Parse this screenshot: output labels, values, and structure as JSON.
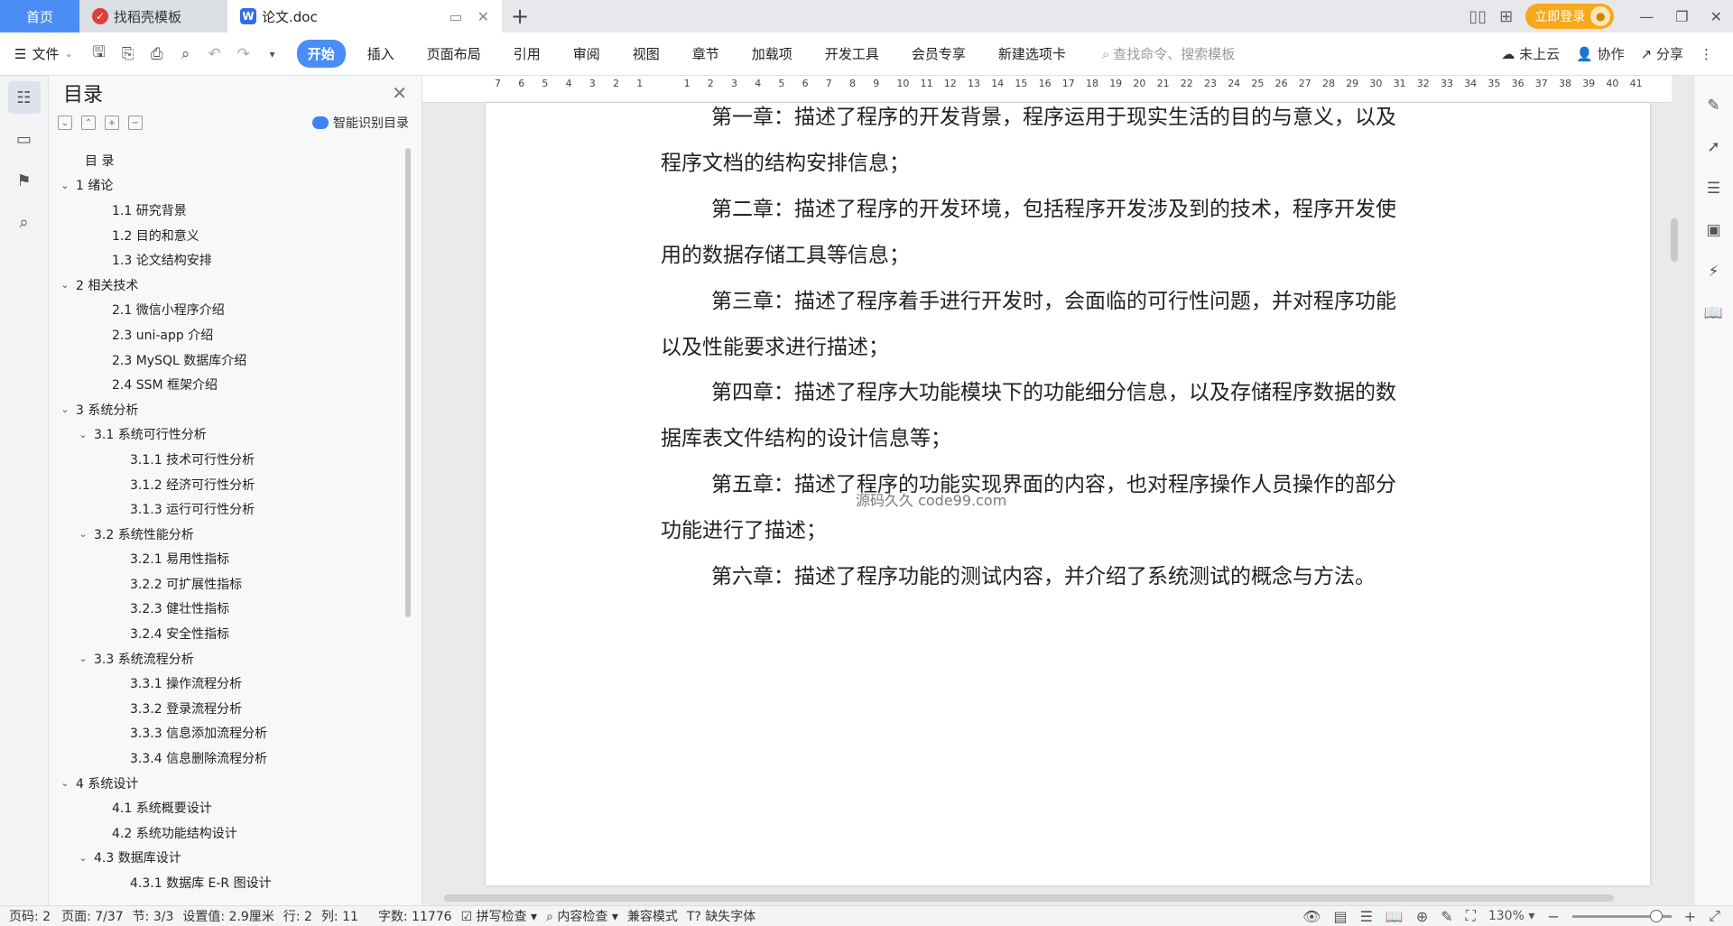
{
  "tabs": {
    "home": "首页",
    "template": "找稻壳模板",
    "doc": "论文.doc"
  },
  "title_right": {
    "login": "立即登录"
  },
  "menu": {
    "file": "文件",
    "ribbon_tabs": [
      "开始",
      "插入",
      "页面布局",
      "引用",
      "审阅",
      "视图",
      "章节",
      "加载项",
      "开发工具",
      "会员专享",
      "新建选项卡"
    ],
    "search_placeholder": "查找命令、搜索模板",
    "cloud": "未上云",
    "collab": "协作",
    "share": "分享"
  },
  "toc": {
    "title": "目录",
    "smart": "智能识别目录",
    "items": [
      {
        "text": "目 录",
        "level": 0,
        "chev": false
      },
      {
        "text": "1 绪论",
        "level": 0,
        "chev": true
      },
      {
        "text": "1.1  研究背景",
        "level": 1,
        "chev": false
      },
      {
        "text": "1.2  目的和意义",
        "level": 1,
        "chev": false
      },
      {
        "text": "1.3  论文结构安排",
        "level": 1,
        "chev": false
      },
      {
        "text": "2 相关技术",
        "level": 0,
        "chev": true
      },
      {
        "text": "2.1  微信小程序介绍",
        "level": 1,
        "chev": false
      },
      {
        "text": "2.3 uni-app 介绍",
        "level": 1,
        "chev": false
      },
      {
        "text": "2.3 MySQL 数据库介绍",
        "level": 1,
        "chev": false
      },
      {
        "text": "2.4 SSM 框架介绍",
        "level": 1,
        "chev": false
      },
      {
        "text": "3 系统分析",
        "level": 0,
        "chev": true
      },
      {
        "text": "3.1  系统可行性分析",
        "level": 1,
        "chev": true
      },
      {
        "text": "3.1.1  技术可行性分析",
        "level": 2,
        "chev": false
      },
      {
        "text": "3.1.2  经济可行性分析",
        "level": 2,
        "chev": false
      },
      {
        "text": "3.1.3  运行可行性分析",
        "level": 2,
        "chev": false
      },
      {
        "text": "3.2  系统性能分析",
        "level": 1,
        "chev": true
      },
      {
        "text": "3.2.1  易用性指标",
        "level": 2,
        "chev": false
      },
      {
        "text": "3.2.2  可扩展性指标",
        "level": 2,
        "chev": false
      },
      {
        "text": "3.2.3  健壮性指标",
        "level": 2,
        "chev": false
      },
      {
        "text": "3.2.4  安全性指标",
        "level": 2,
        "chev": false
      },
      {
        "text": "3.3  系统流程分析",
        "level": 1,
        "chev": true
      },
      {
        "text": "3.3.1  操作流程分析",
        "level": 2,
        "chev": false
      },
      {
        "text": "3.3.2  登录流程分析",
        "level": 2,
        "chev": false
      },
      {
        "text": "3.3.3  信息添加流程分析",
        "level": 2,
        "chev": false
      },
      {
        "text": "3.3.4  信息删除流程分析",
        "level": 2,
        "chev": false
      },
      {
        "text": "4 系统设计",
        "level": 0,
        "chev": true
      },
      {
        "text": "4.1  系统概要设计",
        "level": 1,
        "chev": false
      },
      {
        "text": "4.2  系统功能结构设计",
        "level": 1,
        "chev": false
      },
      {
        "text": "4.3  数据库设计",
        "level": 1,
        "chev": true
      },
      {
        "text": "4.3.1  数据库 E-R 图设计",
        "level": 2,
        "chev": false
      }
    ]
  },
  "ruler_ticks": [
    "7",
    "6",
    "5",
    "4",
    "3",
    "2",
    "1",
    "",
    "1",
    "2",
    "3",
    "4",
    "5",
    "6",
    "7",
    "8",
    "9",
    "10",
    "11",
    "12",
    "13",
    "14",
    "15",
    "16",
    "17",
    "18",
    "19",
    "20",
    "21",
    "22",
    "23",
    "24",
    "25",
    "26",
    "27",
    "28",
    "29",
    "30",
    "31",
    "32",
    "33",
    "34",
    "35",
    "36",
    "37",
    "38",
    "39",
    "40",
    "41"
  ],
  "document": {
    "lines": [
      "第一章：描述了程序的开发背景，程序运用于现实生活的目的与意义，以及",
      "程序文档的结构安排信息；",
      "第二章：描述了程序的开发环境，包括程序开发涉及到的技术，程序开发使",
      "用的数据存储工具等信息；",
      "第三章：描述了程序着手进行开发时，会面临的可行性问题，并对程序功能",
      "以及性能要求进行描述；",
      "第四章：描述了程序大功能模块下的功能细分信息，以及存储程序数据的数",
      "据库表文件结构的设计信息等；",
      "第五章：描述了程序的功能实现界面的内容，也对程序操作人员操作的部分",
      "功能进行了描述；",
      "第六章：描述了程序功能的测试内容，并介绍了系统测试的概念与方法。"
    ],
    "watermark": "源码久久 code99.com"
  },
  "status": {
    "page_code": "页码: 2",
    "page": "页面: 7/37",
    "section": "节: 3/3",
    "setting": "设置值: 2.9厘米",
    "row": "行: 2",
    "col": "列: 11",
    "words": "字数: 11776",
    "spell": "拼写检查",
    "content": "内容检查",
    "compat": "兼容模式",
    "missing_font": "缺失字体",
    "zoom": "130%"
  }
}
